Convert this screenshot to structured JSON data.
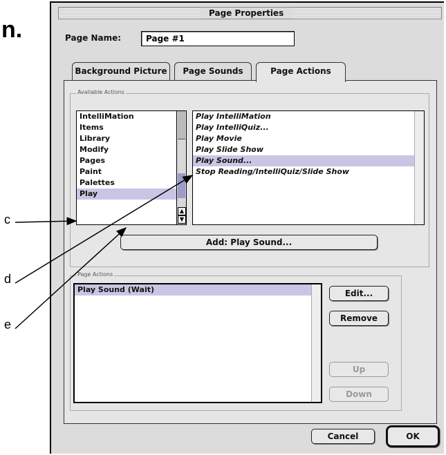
{
  "figure_letter": "n.",
  "callouts": [
    "c",
    "d",
    "e"
  ],
  "dialog": {
    "title": "Page Properties",
    "page_name_label": "Page Name:",
    "page_name_value": "Page #1",
    "tabs": [
      "Background Picture",
      "Page Sounds",
      "Page Actions"
    ],
    "available_actions_label": "Available Actions",
    "categories": [
      "IntelliMation",
      "Items",
      "Library",
      "Modify",
      "Pages",
      "Paint",
      "Palettes",
      "Play"
    ],
    "selected_category": "Play",
    "actions": [
      "Play IntelliMation",
      "Play IntelliQuiz...",
      "Play Movie",
      "Play Slide Show",
      "Play Sound...",
      "Stop Reading/IntelliQuiz/Slide Show"
    ],
    "selected_action": "Play Sound...",
    "add_button": "Add:  Play Sound...",
    "page_actions_label": "Page Actions",
    "page_actions": [
      "Play Sound (Wait)"
    ],
    "edit_button": "Edit...",
    "remove_button": "Remove",
    "up_button": "Up",
    "down_button": "Down",
    "cancel_button": "Cancel",
    "ok_button": "OK"
  },
  "colors": {
    "selection": "#c8c6e4",
    "dialog_bg": "#dcdcdc"
  }
}
